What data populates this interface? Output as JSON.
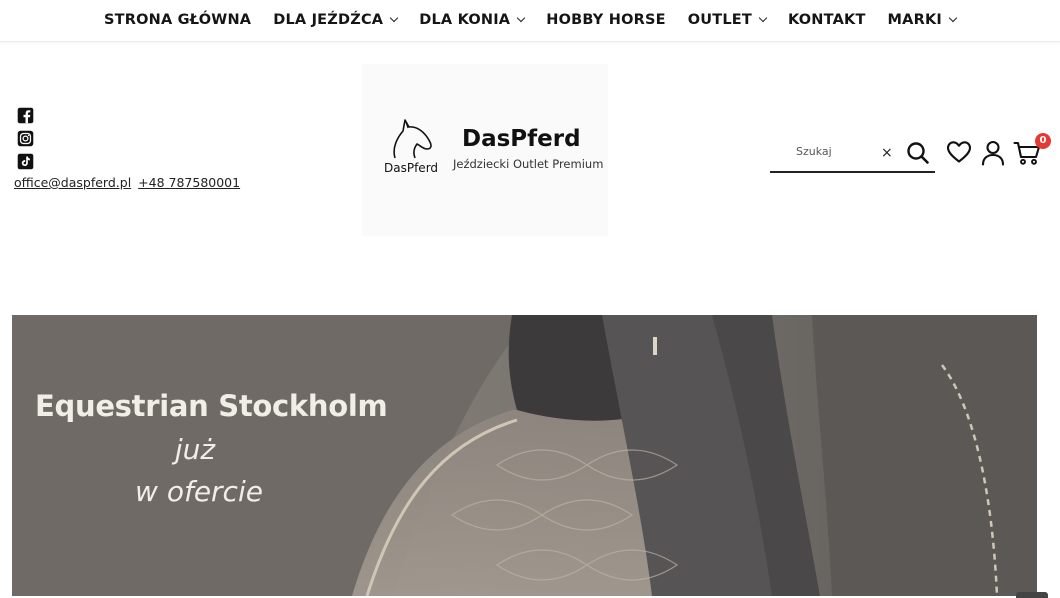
{
  "nav": {
    "items": [
      {
        "label": "STRONA GŁÓWNA",
        "has_dropdown": false
      },
      {
        "label": "DLA JEŹDŹCA",
        "has_dropdown": true
      },
      {
        "label": "DLA KONIA",
        "has_dropdown": true
      },
      {
        "label": "HOBBY HORSE",
        "has_dropdown": false
      },
      {
        "label": "OUTLET",
        "has_dropdown": true
      },
      {
        "label": "KONTAKT",
        "has_dropdown": false
      },
      {
        "label": "MARKI",
        "has_dropdown": true
      }
    ]
  },
  "socials": {
    "icons": [
      "facebook-icon",
      "instagram-icon",
      "tiktok-icon"
    ]
  },
  "contact": {
    "email": "office@daspferd.pl",
    "phone": "+48 787580001"
  },
  "logo": {
    "title": "DasPferd",
    "subtitle": "Jeździecki Outlet Premium",
    "mark_text": "DasPferd"
  },
  "search": {
    "placeholder": "Szukaj",
    "clear_glyph": "×"
  },
  "header_icons": {
    "wishlist": "heart-icon",
    "account": "user-icon",
    "cart": "cart-icon",
    "cart_count": "0",
    "badge_color": "#e53935"
  },
  "hero": {
    "title": "Equestrian Stockholm",
    "line1": "już",
    "line2": "w ofercie",
    "text_color": "#f1ede7"
  }
}
